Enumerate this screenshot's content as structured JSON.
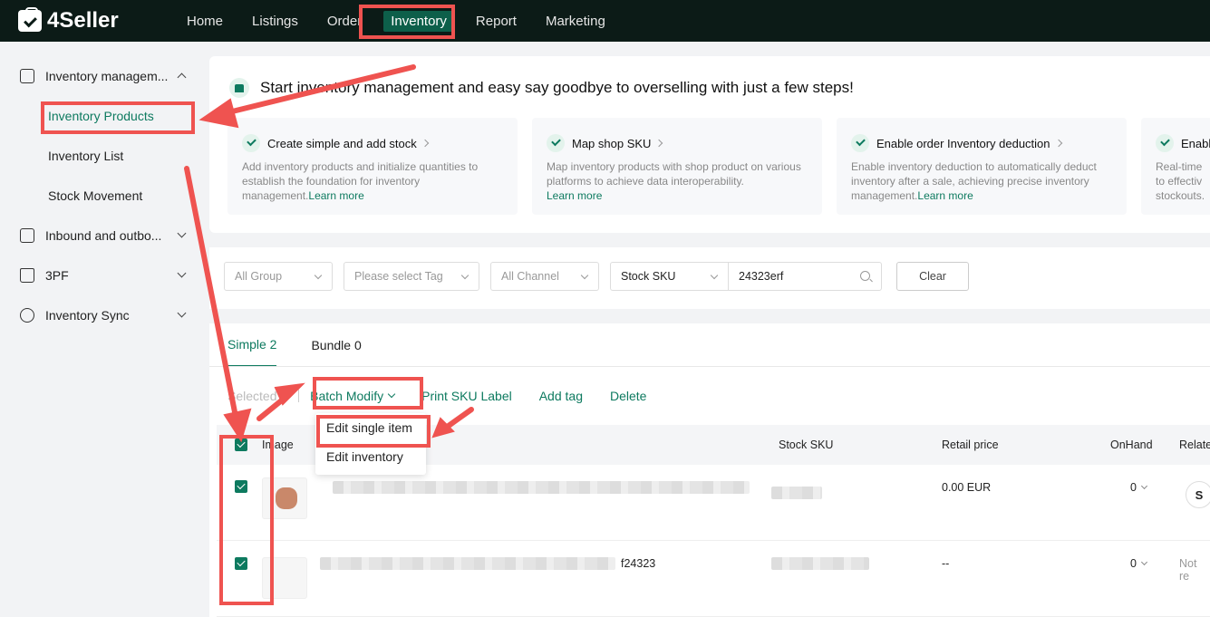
{
  "app": {
    "name": "4Seller"
  },
  "nav": [
    "Home",
    "Listings",
    "Order",
    "Inventory",
    "Report",
    "Marketing"
  ],
  "sidebar": {
    "group1": "Inventory managem...",
    "items": [
      "Inventory Products",
      "Inventory List",
      "Stock Movement"
    ],
    "group2": "Inbound and outbo...",
    "group3": "3PF",
    "group4": "Inventory Sync"
  },
  "banner": {
    "title": "Start inventory management and easy say goodbye to overselling with just a few steps!",
    "steps": [
      {
        "title": "Create simple and add stock",
        "desc": "Add inventory products and initialize quantities to establish the foundation for inventory management.",
        "link": "Learn more"
      },
      {
        "title": "Map shop SKU",
        "desc": "Map inventory products with shop product on various platforms to achieve data interoperability.",
        "link": "Learn more"
      },
      {
        "title": "Enable order Inventory deduction",
        "desc": "Enable inventory deduction to automatically deduct inventory after a sale, achieving precise inventory management.",
        "link": "Learn more"
      },
      {
        "title": "Enabl",
        "desc": "Real-time to effectiv stockouts.",
        "link": ""
      }
    ]
  },
  "filters": {
    "group": "All Group",
    "tag": "Please select Tag",
    "channel": "All Channel",
    "field": "Stock SKU",
    "search_value": "24323erf",
    "clear": "Clear"
  },
  "tabs": [
    "Simple 2",
    "Bundle 0"
  ],
  "toolbar": {
    "selected": "Selected 2",
    "batch_modify": "Batch Modify",
    "print": "Print SKU Label",
    "add_tag": "Add tag",
    "delete": "Delete"
  },
  "batch_menu": [
    "Edit single item",
    "Edit inventory"
  ],
  "table": {
    "columns": [
      "Image",
      "Stock SKU",
      "Retail price",
      "OnHand",
      "Relate"
    ],
    "rows": [
      {
        "name_suffix": "",
        "price": "0.00 EUR",
        "onhand": "0",
        "related": "S"
      },
      {
        "name_suffix": "f24323",
        "price": "--",
        "onhand": "0",
        "related": "Not re"
      }
    ]
  },
  "colors": {
    "accent": "#0d7a5f",
    "topbar": "#0c1b17",
    "annotation": "#ef5350"
  }
}
